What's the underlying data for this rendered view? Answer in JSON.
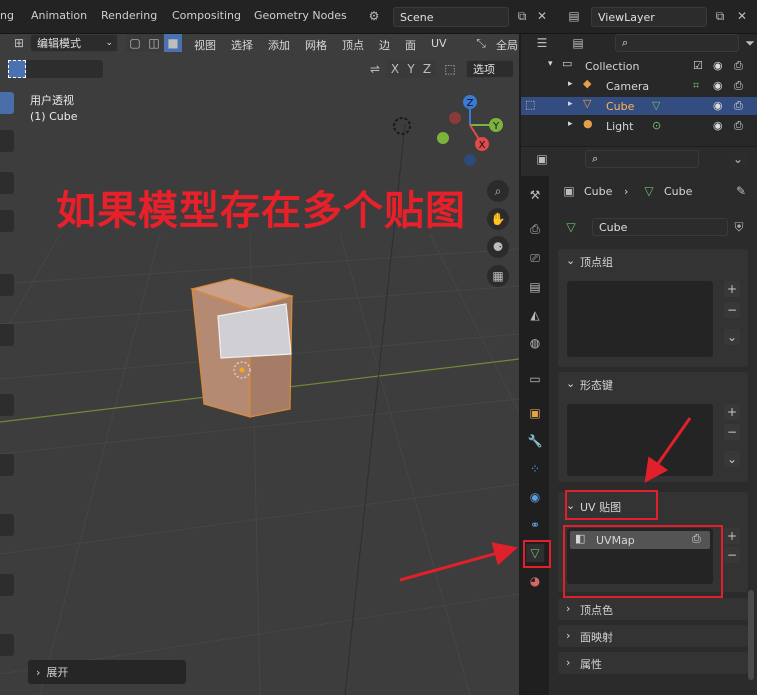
{
  "topbar": {
    "tabs": [
      "ng",
      "Animation",
      "Rendering",
      "Compositing",
      "Geometry Nodes"
    ],
    "scene": "Scene",
    "viewlayer": "ViewLayer"
  },
  "viewport": {
    "mode": "编辑模式",
    "menus": [
      "视图",
      "选择",
      "添加",
      "网格",
      "顶点",
      "边",
      "面",
      "UV"
    ],
    "global": "全局",
    "axes": [
      "X",
      "Y",
      "Z"
    ],
    "options": "选项",
    "view_name": "用户透视",
    "object_name": "(1) Cube",
    "overlay_text": "如果模型存在多个贴图",
    "expand": "展开"
  },
  "outliner": {
    "items": [
      "Collection",
      "Camera",
      "Cube",
      "Light"
    ]
  },
  "properties": {
    "breadcrumb_a": "Cube",
    "breadcrumb_b": "Cube",
    "mesh_name": "Cube",
    "sections": [
      "顶点组",
      "形态键",
      "UV 贴图",
      "顶点色",
      "面映射",
      "属性"
    ],
    "uvmap": "UVMap"
  },
  "colors": {
    "accent": "#3e6fb5",
    "annotation": "#e0202a",
    "selected_text": "#ffb454"
  }
}
